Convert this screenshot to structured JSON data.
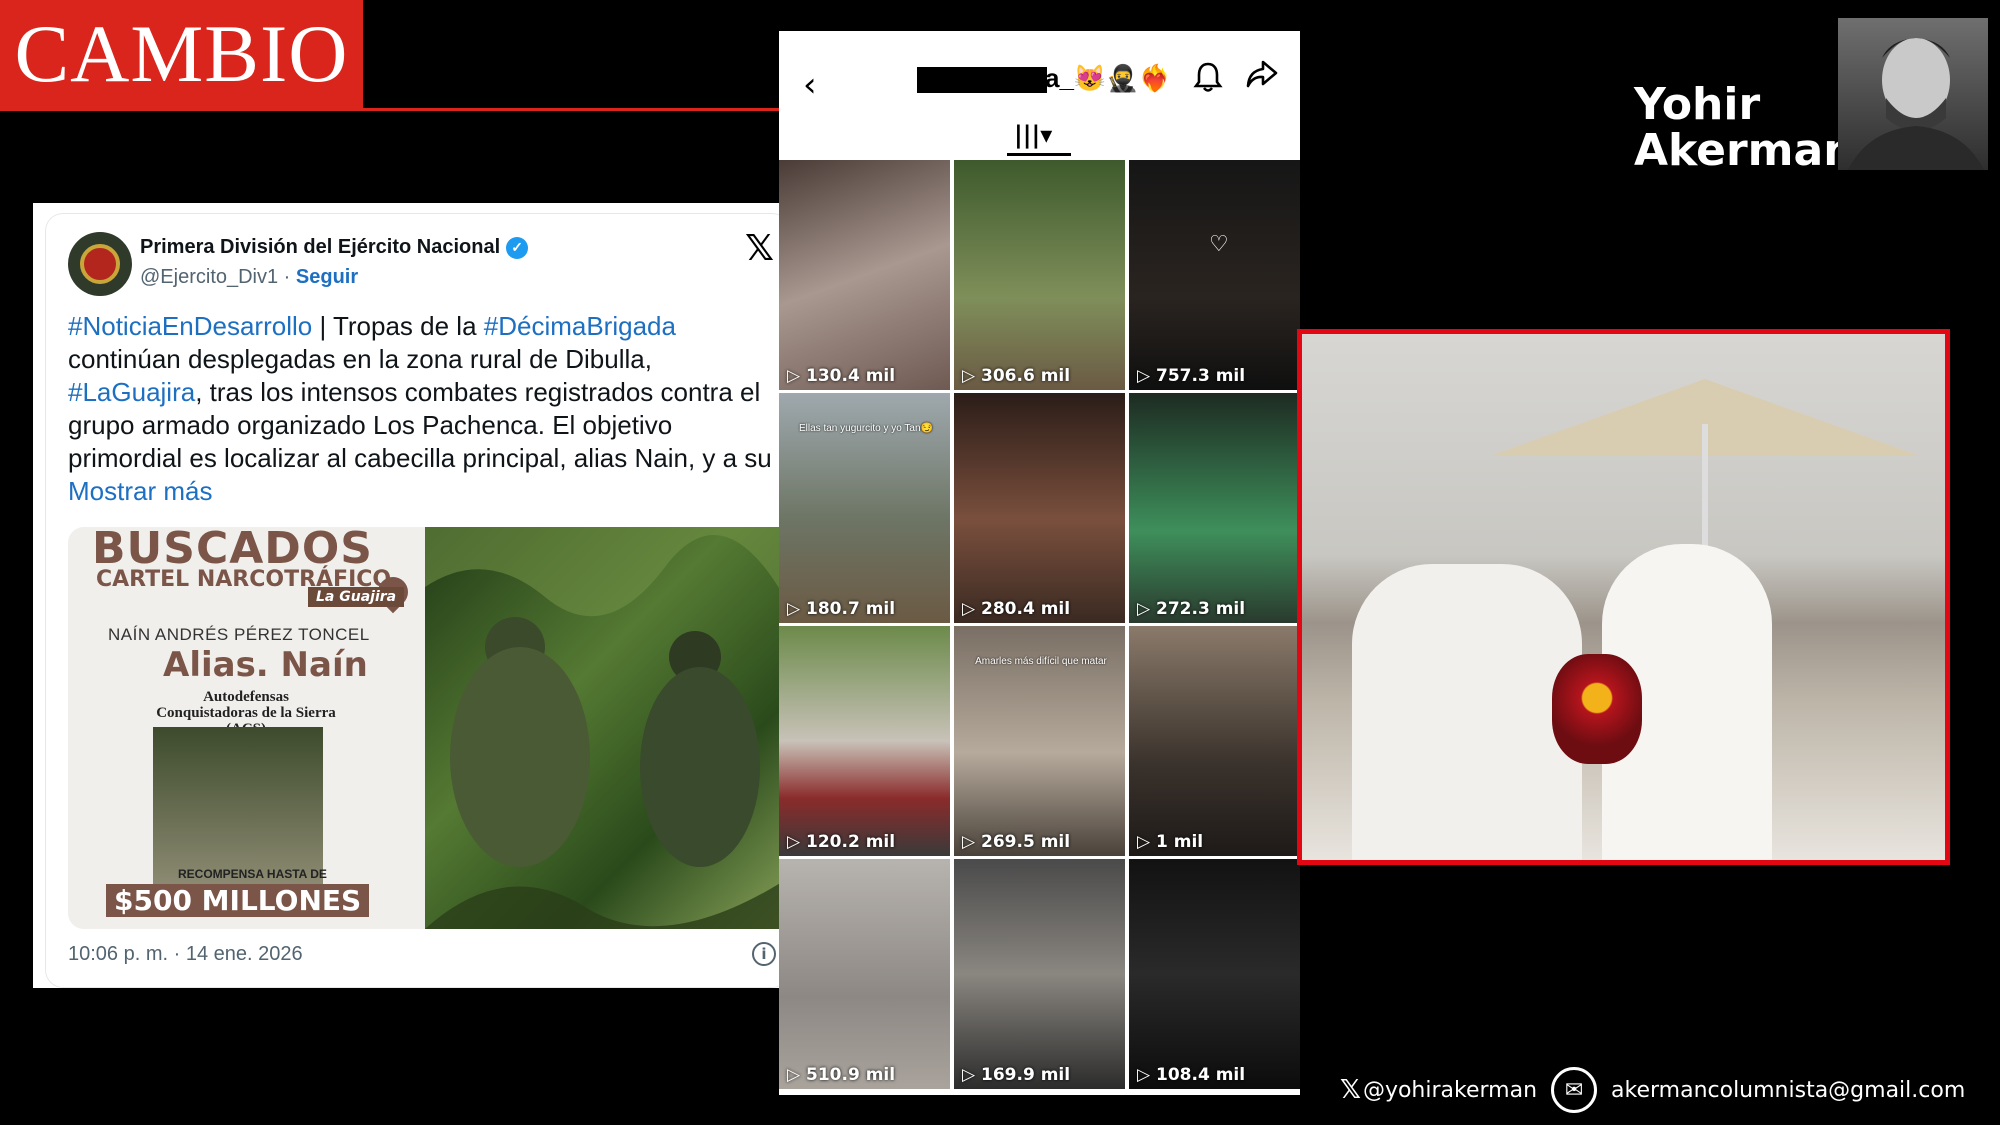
{
  "brand": {
    "name": "CAMBIO",
    "color": "#d9251c"
  },
  "author": {
    "name_line1": "Yohir",
    "name_line2": "Akerman"
  },
  "tweet": {
    "account_name": "Primera División del Ejército Nacional",
    "handle": "@Ejercito_Div1",
    "separator": " · ",
    "follow_label": "Seguir",
    "body": [
      {
        "t": "#NoticiaEnDesarrollo",
        "hl": true
      },
      {
        "t": " | Tropas de la ",
        "hl": false
      },
      {
        "t": "#DécimaBrigada",
        "hl": true
      },
      {
        "t": " continúan desplegadas en la zona rural de Dibulla, ",
        "hl": false
      },
      {
        "t": "#LaGuajira",
        "hl": true
      },
      {
        "t": ", tras los intensos combates registrados contra el grupo armado organizado Los Pachenca. El objetivo primordial es localizar al cabecilla principal, alias Nain, y a su ",
        "hl": false
      },
      {
        "t": "Mostrar más",
        "hl": true
      }
    ],
    "timestamp": "10:06 p. m. · 14 ene. 2026",
    "poster": {
      "headline": "BUSCADOS",
      "subheadline": "CARTEL NARCOTRÁFICO",
      "region_tag": "La Guajira",
      "full_name": "NAÍN ANDRÉS PÉREZ TONCEL",
      "alias": "Alias. Naín",
      "group": "Autodefensas Conquistadoras de la Sierra (ACS)",
      "reward_label": "RECOMPENSA HASTA DE",
      "reward_amount": "$500 MILLONES"
    }
  },
  "phone": {
    "title_suffix": "a_😻🥷❤️‍🔥",
    "tab_icon": "|||▾",
    "cells": [
      {
        "views": "130.4 mil",
        "caption": "",
        "bg": "linear-gradient(160deg,#4a3b36,#a89890 50%,#6f5a52)"
      },
      {
        "views": "306.6 mil",
        "caption": "",
        "bg": "linear-gradient(180deg,#3e5a2c,#7f8f5a 60%,#6b5a44)"
      },
      {
        "views": "757.3 mil",
        "caption": "",
        "bg": "linear-gradient(180deg,#161616,#2a2420 60%,#0f0f0f)"
      },
      {
        "views": "180.7 mil",
        "caption": "Ellas tan yugurcito y yo Tan😏",
        "bg": "linear-gradient(180deg,#9fa9ae,#6d7565 55%,#6b5a44)"
      },
      {
        "views": "280.4 mil",
        "caption": "",
        "bg": "linear-gradient(180deg,#2b1d18,#7a4f3d 55%,#3a2a22)"
      },
      {
        "views": "272.3 mil",
        "caption": "",
        "bg": "linear-gradient(180deg,#1d2b22,#3e8f5b 60%,#2a3a2e)"
      },
      {
        "views": "120.2 mil",
        "caption": "",
        "bg": "linear-gradient(180deg,#6c8a4a,#c8c2b8 50%,#8a2b2b 75%,#3a3a3a)"
      },
      {
        "views": "269.5 mil",
        "caption": "Amarles más difícil que matar",
        "bg": "linear-gradient(180deg,#7a6f64,#b6aa9c 55%,#4a423a)"
      },
      {
        "views": "1 mil",
        "caption": "",
        "bg": "linear-gradient(180deg,#8a7a6a,#3a322c 60%,#1e1a18)"
      },
      {
        "views": "510.9 mil",
        "caption": "",
        "bg": "linear-gradient(180deg,#b7b3ae,#8d8884 60%,#a9a39c)"
      },
      {
        "views": "169.9 mil",
        "caption": "",
        "bg": "linear-gradient(180deg,#4a4a4a,#8a8680 50%,#2c2c2c)"
      },
      {
        "views": "108.4 mil",
        "caption": "",
        "bg": "linear-gradient(180deg,#121212,#2a2a2a 50%,#0c0c0c)"
      }
    ]
  },
  "footer": {
    "x_handle": "@yohirakerman",
    "email": "akermancolumnista@gmail.com"
  },
  "colors": {
    "accent_red": "#d9251c",
    "link_blue": "#1d6fc2",
    "frame_red": "#e30613"
  }
}
